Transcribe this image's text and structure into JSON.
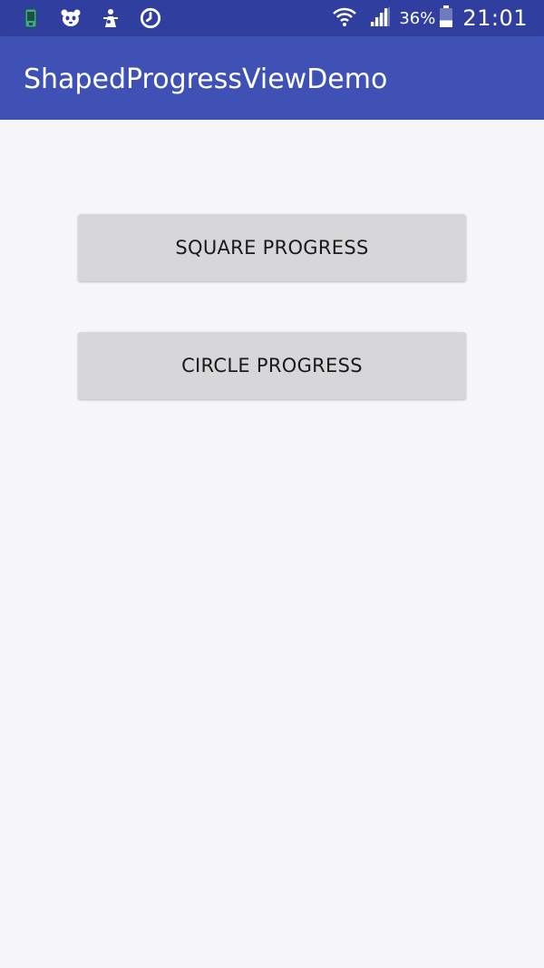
{
  "status_bar": {
    "left_icons": [
      "phone-sim-icon",
      "panda-icon",
      "android-debug-icon",
      "sync-circle-icon"
    ],
    "wifi_icon": "wifi-icon",
    "signal_icon": "signal-icon",
    "battery_percent": "36%",
    "battery_level": 0.36,
    "battery_icon": "battery-icon",
    "time": "21:01",
    "color": "#303f9f"
  },
  "app_bar": {
    "title": "ShapedProgressViewDemo",
    "color": "#3f51b5"
  },
  "buttons": {
    "square_label": "SQUARE PROGRESS",
    "circle_label": "CIRCLE PROGRESS"
  },
  "colors": {
    "background": "#f6f5f8",
    "button": "#d7d6d8",
    "button_text": "#1a1a1a"
  }
}
